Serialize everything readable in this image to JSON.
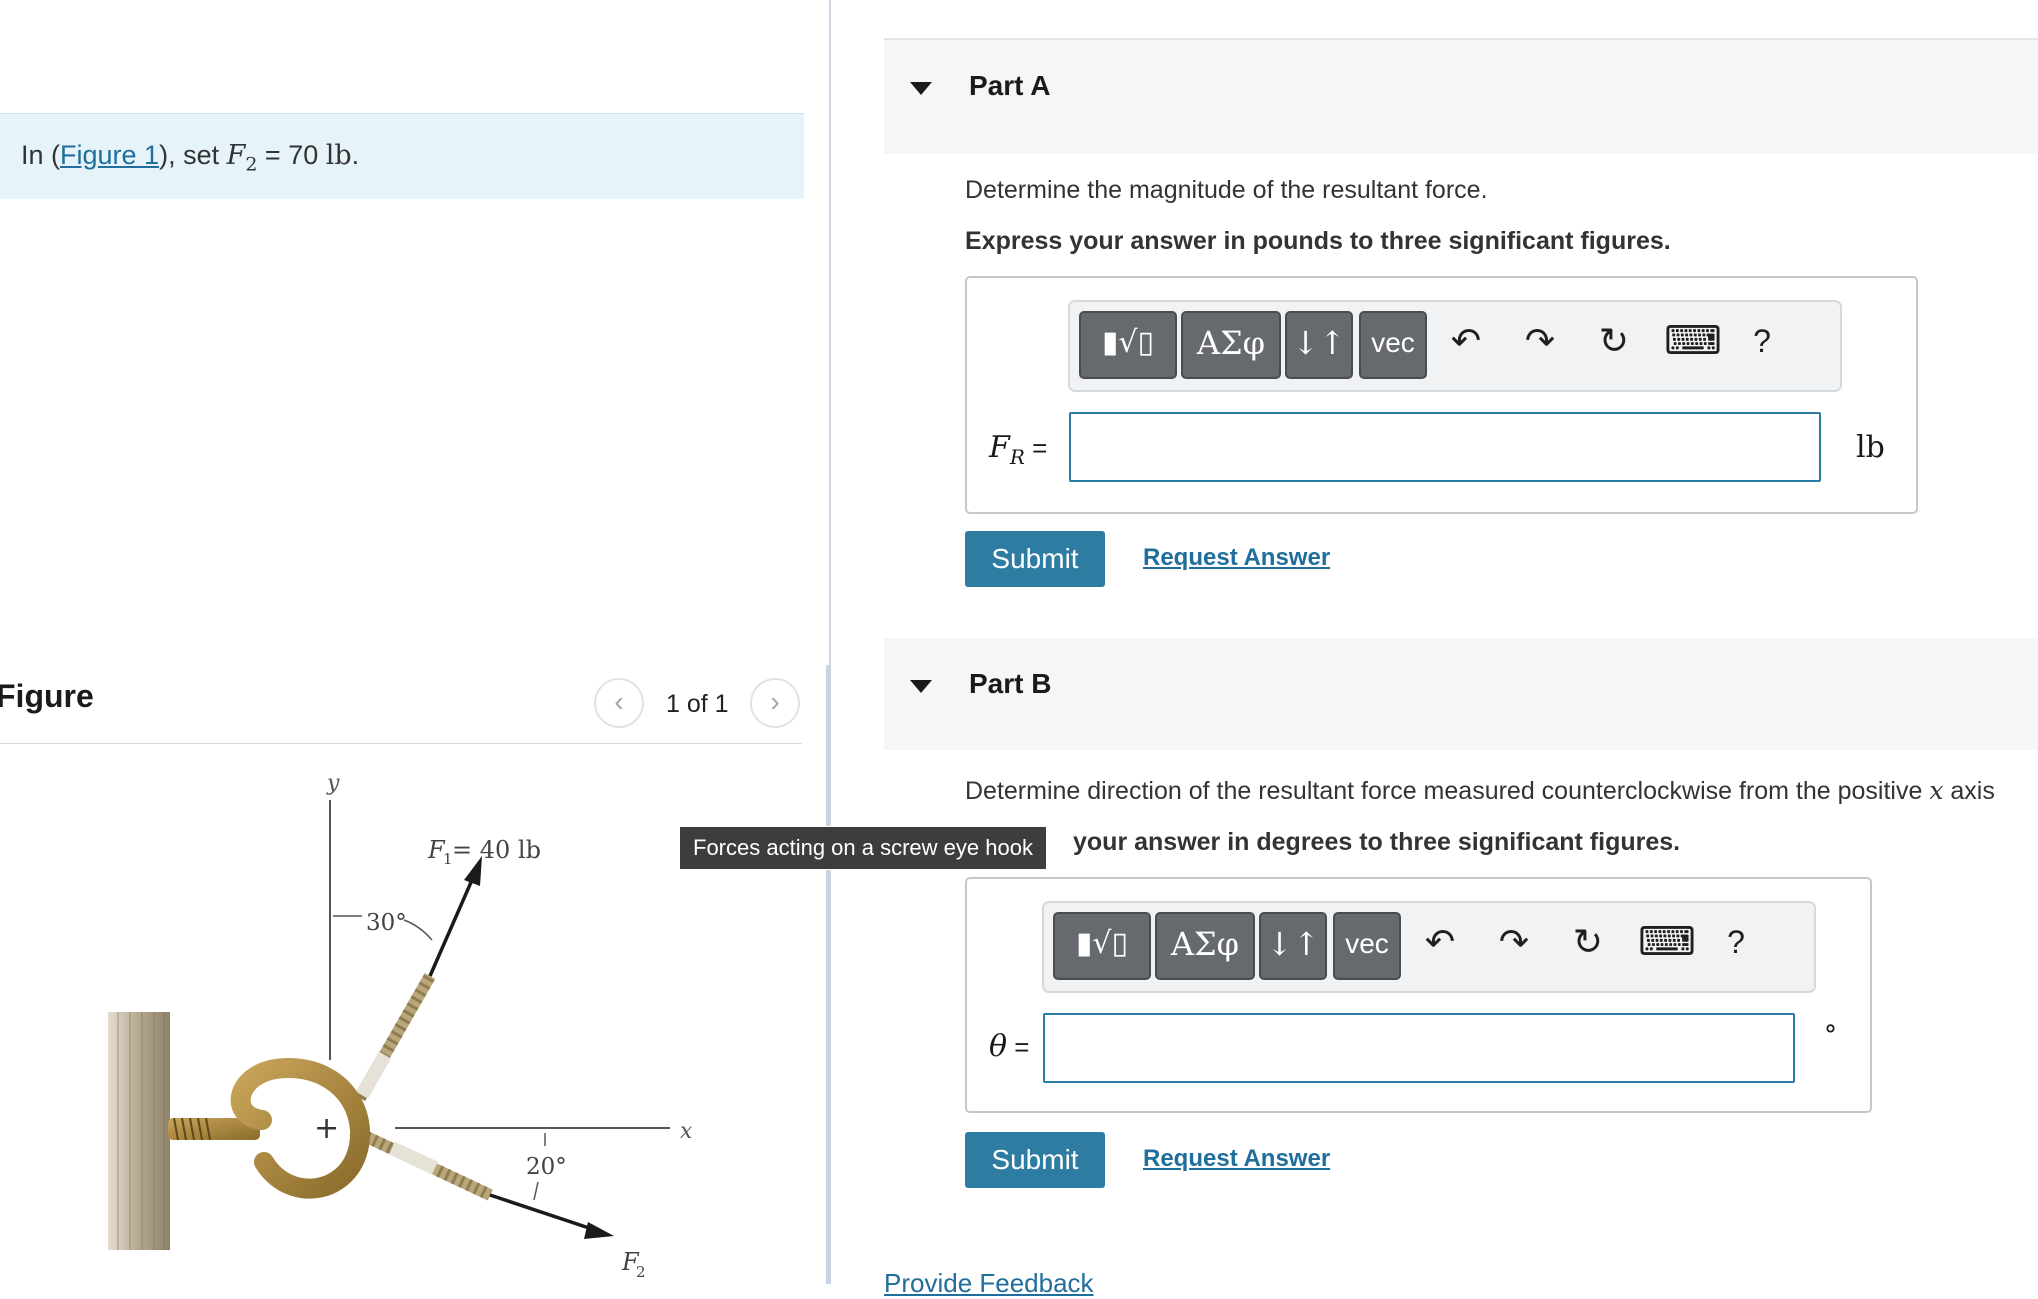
{
  "prompt": {
    "pre": "In (",
    "link": "Figure 1",
    "mid": "), set ",
    "var": "F",
    "sub": "2",
    "eq": " = 70 ",
    "unit": "lb",
    "end": "."
  },
  "figure": {
    "title": "Figure",
    "pager_count": "1 of 1",
    "prev_icon": "‹",
    "next_icon": "›",
    "tooltip": "Forces acting on a screw eye hook",
    "labels": {
      "y_axis": "y",
      "x_axis": "x",
      "f1": "F",
      "f1_sub": "1",
      "f1_value": " = 40 lb",
      "angle_30": "30°",
      "angle_20": "20°",
      "f2": "F",
      "f2_sub": "2",
      "origin": "+"
    }
  },
  "toolbar": {
    "template": "▮√▯",
    "greek": "ΑΣφ",
    "arrows": "↓↑",
    "vec": "vec",
    "undo": "↶",
    "redo": "↷",
    "reset": "↻",
    "keyboard": "⌨",
    "help": "?"
  },
  "part_a": {
    "title": "Part A",
    "question": "Determine the magnitude of the resultant force.",
    "instruction": "Express your answer in pounds to three significant figures.",
    "var": "F",
    "var_sub": "R",
    "equals": " =",
    "unit": "lb",
    "input_value": "",
    "submit": "Submit",
    "request": "Request Answer"
  },
  "part_b": {
    "title": "Part B",
    "question_pre": "Determine direction of the resultant force measured counterclockwise from the positive ",
    "question_var": "x",
    "question_post": " axis",
    "instruction": "your answer in degrees to three significant figures.",
    "var": "θ",
    "equals": " =",
    "unit": "°",
    "input_value": "",
    "submit": "Submit",
    "request": "Request Answer"
  },
  "feedback": "Provide Feedback"
}
